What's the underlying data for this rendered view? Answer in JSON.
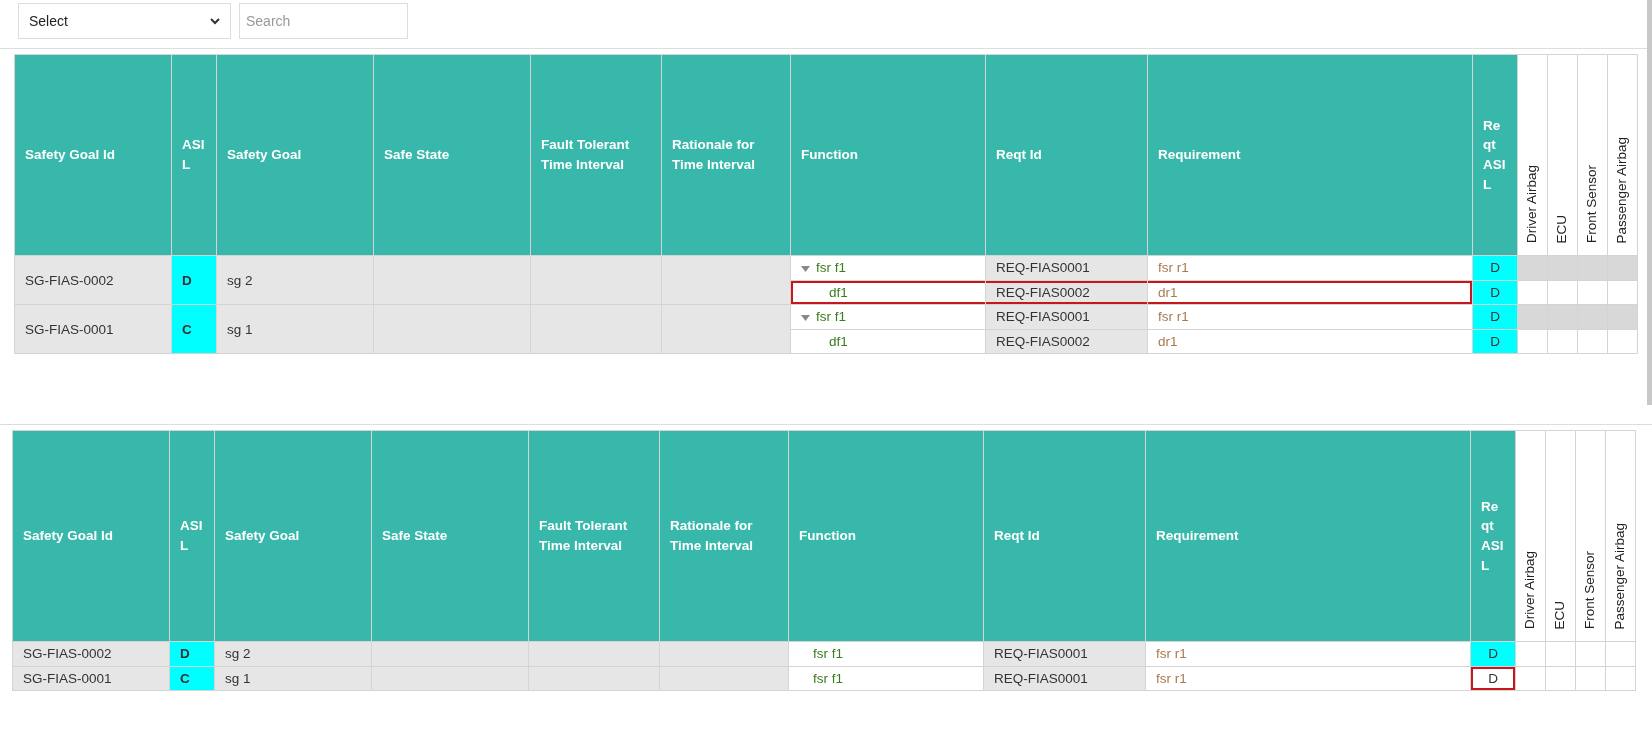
{
  "toolbar": {
    "select": {
      "value": "Select"
    },
    "search": {
      "placeholder": "Search"
    }
  },
  "tables": [
    {
      "columns": [
        "Safety Goal Id",
        "ASIL",
        "Safety Goal",
        "Safe State",
        "Fault Tolerant Time Interval",
        "Rationale for Time Interval",
        "Function",
        "Reqt Id",
        "Requirement",
        "Reqt ASIL"
      ],
      "component_columns": [
        "Driver Airbag",
        "ECU",
        "Front Sensor",
        "Passenger Airbag"
      ],
      "rows": [
        {
          "goal_id": "SG-FIAS-0002",
          "asil": "D",
          "safety_goal": "sg 2",
          "requirements": [
            {
              "kind": "parent",
              "expanded": true,
              "function": "fsr f1",
              "reqt_id": "REQ-FIAS0001",
              "requirement": "fsr r1",
              "reqt_asil": "D",
              "asil_filled": true,
              "row_outlined": false,
              "asil_outlined": false
            },
            {
              "kind": "child",
              "function": "df1",
              "reqt_id": "REQ-FIAS0002",
              "requirement": "dr1",
              "reqt_asil": "D",
              "asil_filled": true,
              "row_outlined": true,
              "asil_outlined": false
            }
          ]
        },
        {
          "goal_id": "SG-FIAS-0001",
          "asil": "C",
          "safety_goal": "sg 1",
          "requirements": [
            {
              "kind": "parent",
              "expanded": true,
              "function": "fsr f1",
              "reqt_id": "REQ-FIAS0001",
              "requirement": "fsr r1",
              "reqt_asil": "D",
              "asil_filled": true,
              "row_outlined": false,
              "asil_outlined": false
            },
            {
              "kind": "child",
              "function": "df1",
              "reqt_id": "REQ-FIAS0002",
              "requirement": "dr1",
              "reqt_asil": "D",
              "asil_filled": true,
              "row_outlined": false,
              "asil_outlined": false
            }
          ]
        }
      ]
    },
    {
      "columns": [
        "Safety Goal Id",
        "ASIL",
        "Safety Goal",
        "Safe State",
        "Fault Tolerant Time Interval",
        "Rationale for Time Interval",
        "Function",
        "Reqt Id",
        "Requirement",
        "Reqt ASIL"
      ],
      "component_columns": [
        "Driver Airbag",
        "ECU",
        "Front Sensor",
        "Passenger Airbag"
      ],
      "rows": [
        {
          "goal_id": "SG-FIAS-0002",
          "asil": "D",
          "safety_goal": "sg 2",
          "requirements": [
            {
              "kind": "flat",
              "function": "fsr f1",
              "reqt_id": "REQ-FIAS0001",
              "requirement": "fsr r1",
              "reqt_asil": "D",
              "asil_filled": true,
              "row_outlined": false,
              "asil_outlined": false
            }
          ]
        },
        {
          "goal_id": "SG-FIAS-0001",
          "asil": "C",
          "safety_goal": "sg 1",
          "requirements": [
            {
              "kind": "flat",
              "function": "fsr f1",
              "reqt_id": "REQ-FIAS0001",
              "requirement": "fsr r1",
              "reqt_asil": "D",
              "asil_filled": false,
              "row_outlined": false,
              "asil_outlined": true
            }
          ]
        }
      ]
    }
  ]
}
